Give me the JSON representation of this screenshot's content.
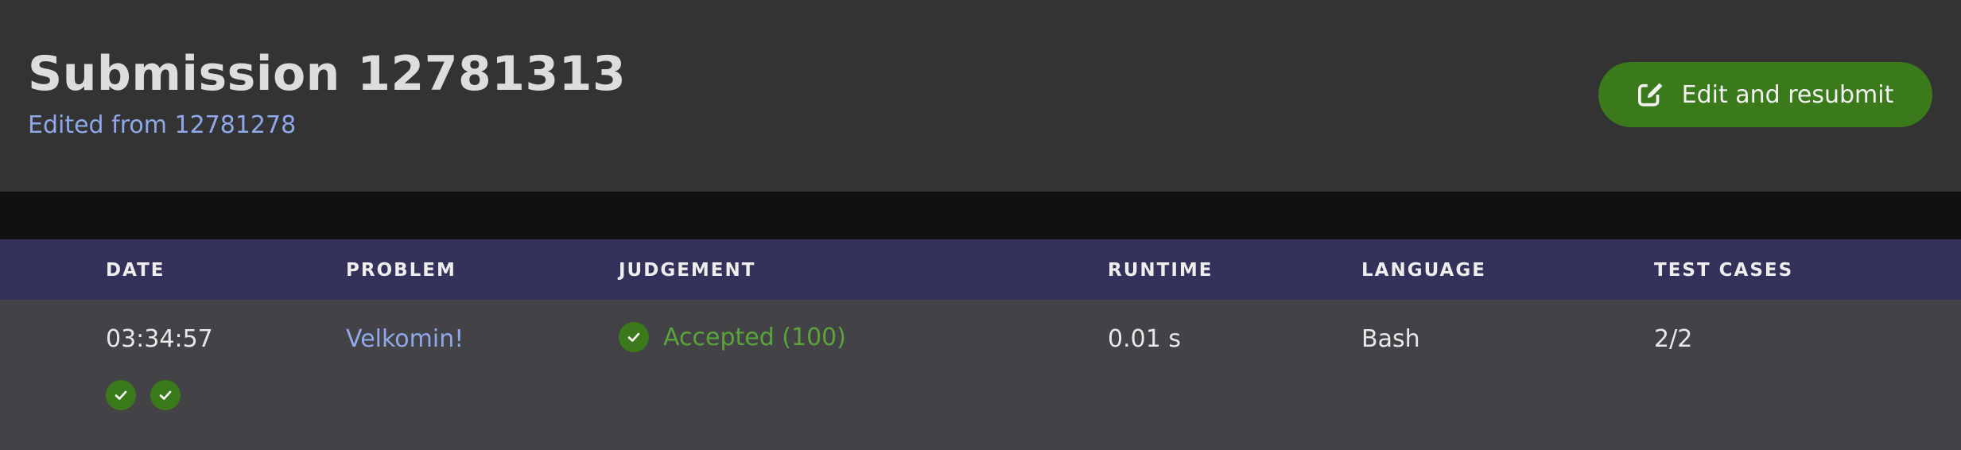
{
  "header": {
    "title": "Submission 12781313",
    "subtitle_prefix": "Edited from",
    "subtitle_link": "12781278",
    "resubmit_label": "Edit and resubmit"
  },
  "table": {
    "columns": [
      "DATE",
      "PROBLEM",
      "JUDGEMENT",
      "RUNTIME",
      "LANGUAGE",
      "TEST CASES"
    ],
    "row": {
      "date": "03:34:57",
      "problem": "Velkomin!",
      "judgement": "Accepted (100)",
      "runtime": "0.01 s",
      "language": "Bash",
      "test_cases": "2/2"
    },
    "test_case_results": [
      "accepted",
      "accepted"
    ]
  },
  "colors": {
    "header_bg": "#333333",
    "table_header_bg": "#34325a",
    "row_bg": "#434246",
    "accent_green": "#3a7a1a",
    "accepted_text": "#5aa53a",
    "link": "#8fa8ea"
  },
  "icons": {
    "resubmit": "edit-icon",
    "status": "check-circle-icon"
  }
}
